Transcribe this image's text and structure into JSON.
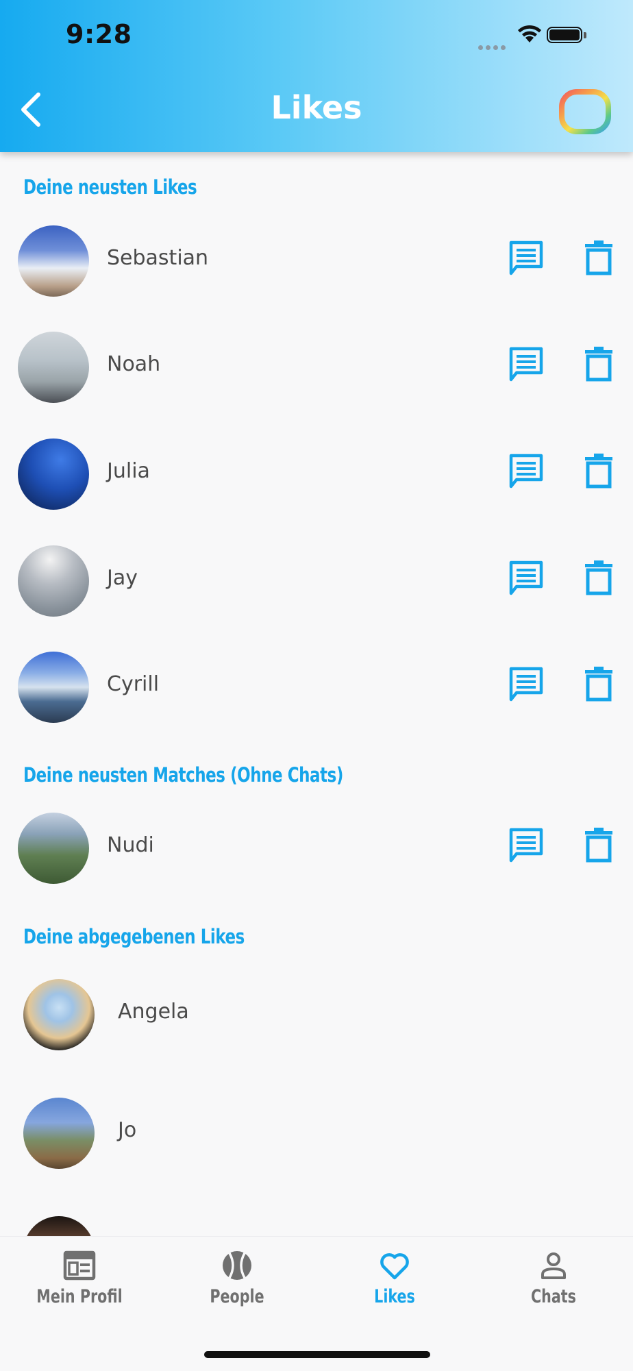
{
  "status_bar": {
    "time": "9:28"
  },
  "header": {
    "title": "Likes",
    "back_icon": "chevron-left-icon",
    "logo_icon": "rainbow-rounded-square-logo"
  },
  "colors": {
    "accent": "#16a5ea",
    "header_gradient_start": "#16aaf0",
    "header_gradient_end": "#bfe9fc",
    "text": "#4a4a4a"
  },
  "sections": {
    "recent_likes": {
      "title": "Deine neusten Likes",
      "items": [
        {
          "name": "Sebastian"
        },
        {
          "name": "Noah"
        },
        {
          "name": "Julia"
        },
        {
          "name": "Jay"
        },
        {
          "name": "Cyrill"
        }
      ]
    },
    "recent_matches": {
      "title": "Deine neusten Matches (Ohne Chats)",
      "items": [
        {
          "name": "Nudi"
        }
      ]
    },
    "given_likes": {
      "title": "Deine abgegebenen Likes",
      "items": [
        {
          "name": "Angela"
        },
        {
          "name": "Jo"
        }
      ]
    }
  },
  "row_actions": {
    "chat_icon": "chat-bubble-icon",
    "delete_icon": "trash-icon"
  },
  "bottom_nav": {
    "items": [
      {
        "label": "Mein Profil",
        "icon": "profile-card-icon",
        "active": false
      },
      {
        "label": "People",
        "icon": "tennis-ball-icon",
        "active": false
      },
      {
        "label": "Likes",
        "icon": "heart-icon",
        "active": true
      },
      {
        "label": "Chats",
        "icon": "person-icon",
        "active": false
      }
    ]
  }
}
